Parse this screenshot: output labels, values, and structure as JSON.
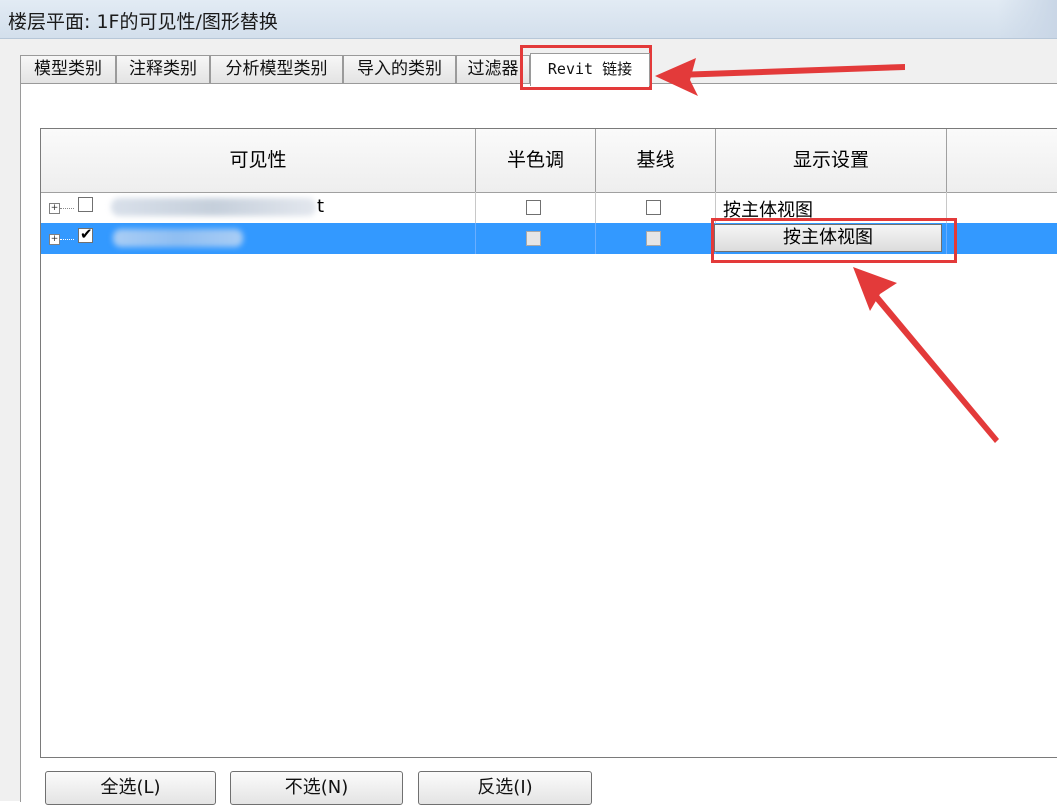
{
  "window": {
    "title": "楼层平面: 1F的可见性/图形替换"
  },
  "tabs": [
    {
      "label": "模型类别"
    },
    {
      "label": "注释类别"
    },
    {
      "label": "分析模型类别"
    },
    {
      "label": "导入的类别"
    },
    {
      "label": "过滤器"
    },
    {
      "label": "Revit 链接",
      "active": true
    }
  ],
  "grid": {
    "columns": [
      "可见性",
      "半色调",
      "基线",
      "显示设置"
    ],
    "rows": [
      {
        "name_visible": "t",
        "visible": false,
        "halftone": false,
        "underlay": false,
        "display": "按主体视图",
        "selected": false
      },
      {
        "name_visible": "",
        "visible": true,
        "halftone": false,
        "underlay": false,
        "display": "按主体视图",
        "selected": true
      }
    ]
  },
  "buttons": {
    "select_all": "全选(L)",
    "select_none": "不选(N)",
    "invert": "反选(I)"
  },
  "colors": {
    "selection": "#3399ff",
    "annotation": "#e33a3a"
  }
}
